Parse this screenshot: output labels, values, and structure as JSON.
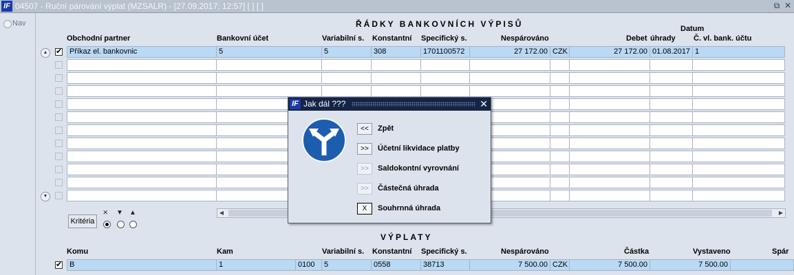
{
  "window": {
    "title": "04507 - Ruční párování výplat (MZSALR) - [27.09.2017; 12:57]  [ ]  [ ]",
    "restore_icon": "restore-window-icon",
    "close_icon": "close-icon"
  },
  "nav": {
    "label": "Nav"
  },
  "bank_section": {
    "title": "ŘÁDKY BANKOVNÍCH VÝPISŮ",
    "headers": {
      "partner": "Obchodní partner",
      "account": "Bankovní účet",
      "variable": "Variabilní s.",
      "constant": "Konstantní",
      "specific": "Specifický s.",
      "unpaired": "Nespárováno",
      "debit": "Debet",
      "date_top": "Datum",
      "date_bottom": "úhrady",
      "own_account": "Č. vl. bank. účtu"
    },
    "rows": [
      {
        "checked": true,
        "partner": "Příkaz el. bankovnic",
        "account": "5",
        "variable": "5",
        "constant": "308",
        "specific": "1701100572",
        "unpaired": "27 172.00",
        "currency": "CZK",
        "debit": "27 172.00",
        "date": "01.08.2017",
        "own_account": "1"
      }
    ],
    "criteria_label": "Kritéria"
  },
  "payments_section": {
    "title": "VÝPLATY",
    "headers": {
      "to": "Komu",
      "where": "Kam",
      "variable": "Variabilní s.",
      "constant": "Konstantní",
      "specific": "Specifický s.",
      "unpaired": "Nespárováno",
      "amount": "Částka",
      "issued": "Vystaveno",
      "paired": "Spár"
    },
    "rows": [
      {
        "checked": true,
        "to": "B",
        "where": "1",
        "bank_code": "0100",
        "variable": "5",
        "constant": "0558",
        "specific": "38713",
        "unpaired": "7 500.00",
        "currency": "CZK",
        "amount": "7 500.00",
        "issued": "7 500.00"
      }
    ]
  },
  "dialog": {
    "title": "Jak dál ???",
    "options": [
      {
        "btn": "<<",
        "label": "Zpět",
        "enabled": true
      },
      {
        "btn": ">>",
        "label": "Účetní likvidace platby",
        "enabled": true
      },
      {
        "btn": ">>",
        "label": "Saldokontní vyrovnání",
        "enabled": false
      },
      {
        "btn": ">>",
        "label": "Částečná úhrada",
        "enabled": false
      },
      {
        "btn": "X",
        "label": "Souhrnná úhrada",
        "enabled": true
      }
    ]
  },
  "colors": {
    "selected_row": "#b9d9f5",
    "dialog_title_bg": "#152446",
    "sign_blue": "#1d5dae"
  }
}
